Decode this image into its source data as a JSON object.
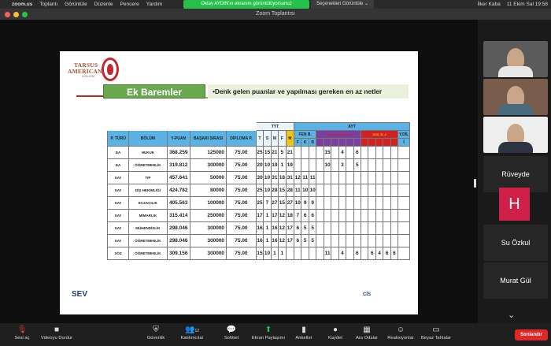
{
  "menubar": {
    "apple": "",
    "app": "zoom.us",
    "items": [
      "Toplantı",
      "Görüntüle",
      "Düzenle",
      "Pencere",
      "Yardım"
    ],
    "share_banner": "Oktay AYDIN'ın ekranını görüntülüyorsunuz",
    "share_options": "Seçenekleri Görüntüle ⌄",
    "user": "İlker Kaba",
    "datetime": "11 Ekim Sal 19:58"
  },
  "window": {
    "title": "Zoom Toplantısı"
  },
  "slide": {
    "logo": [
      "TARSUS",
      "AMERICAN",
      "COLLEGE"
    ],
    "heading": "Ek Baremler",
    "subheading": "•Denk gelen puanlar ve yapılması gereken en az netler",
    "table": {
      "header_top": [
        "TYT",
        "AYT"
      ],
      "columns": [
        "P. TÜRÜ",
        "BÖLÜM",
        "Y-PUAN",
        "BAŞARI SIRASI",
        "DİPLOMA P."
      ],
      "tyt_sub": [
        "T",
        "S",
        "M",
        "F"
      ],
      "m": "M",
      "fen_b": "FEN B.",
      "fen_sub": [
        "F",
        "K",
        "B"
      ],
      "ayt_groups": [
        "T. ED. ve SOS. B.-1",
        "SOS. B.-2"
      ],
      "ydil": "Y.DİL",
      "ydil_sub": "İ",
      "rows": [
        {
          "ptype": "EA",
          "dept": "HUKUK",
          "ypuan": "368.259",
          "rank": "125000",
          "dip": "75.00",
          "tyt": [
            "25",
            "15",
            "21",
            "5"
          ],
          "m": "21",
          "fen": [
            "",
            "",
            ""
          ],
          "s1": [
            "",
            "15",
            "",
            "4",
            "",
            "6"
          ],
          "s2": [
            "",
            "",
            "",
            "",
            ""
          ],
          "ydil": ""
        },
        {
          "ptype": "EA",
          "dept": "ÖĞRETMENLİK",
          "ypuan": "319.812",
          "rank": "300000",
          "dip": "75.00",
          "tyt": [
            "20",
            "10",
            "19",
            "1"
          ],
          "m": "19",
          "fen": [
            "",
            "",
            ""
          ],
          "s1": [
            "",
            "10",
            "",
            "3",
            "",
            "5"
          ],
          "s2": [
            "",
            "",
            "",
            "",
            ""
          ],
          "ydil": ""
        },
        {
          "ptype": "SAY",
          "dept": "TIP",
          "ypuan": "457.641",
          "rank": "50000",
          "dip": "75.00",
          "tyt": [
            "30",
            "10",
            "31",
            "18"
          ],
          "m": "31",
          "fen": [
            "12",
            "11",
            "11"
          ],
          "s1": [
            "",
            "",
            "",
            "",
            "",
            ""
          ],
          "s2": [
            "",
            "",
            "",
            "",
            ""
          ],
          "ydil": ""
        },
        {
          "ptype": "SAY",
          "dept": "DİŞ HEKİMLİĞİ",
          "ypuan": "424.782",
          "rank": "80000",
          "dip": "75.00",
          "tyt": [
            "25",
            "10",
            "28",
            "15"
          ],
          "m": "28",
          "fen": [
            "11",
            "10",
            "10"
          ],
          "s1": [
            "",
            "",
            "",
            "",
            "",
            ""
          ],
          "s2": [
            "",
            "",
            "",
            "",
            ""
          ],
          "ydil": ""
        },
        {
          "ptype": "SAY",
          "dept": "ECZACILIK",
          "ypuan": "405.563",
          "rank": "100000",
          "dip": "75.00",
          "tyt": [
            "25",
            "7",
            "27",
            "15"
          ],
          "m": "27",
          "fen": [
            "10",
            "9",
            "9"
          ],
          "s1": [
            "",
            "",
            "",
            "",
            "",
            ""
          ],
          "s2": [
            "",
            "",
            "",
            "",
            ""
          ],
          "ydil": ""
        },
        {
          "ptype": "SAY",
          "dept": "MİMARLIK",
          "ypuan": "315.414",
          "rank": "250000",
          "dip": "75.00",
          "tyt": [
            "17",
            "1",
            "17",
            "12"
          ],
          "m": "18",
          "fen": [
            "7",
            "6",
            "6"
          ],
          "s1": [
            "",
            "",
            "",
            "",
            "",
            ""
          ],
          "s2": [
            "",
            "",
            "",
            "",
            ""
          ],
          "ydil": ""
        },
        {
          "ptype": "SAY",
          "dept": "MÜHENDİSLİK",
          "ypuan": "298.046",
          "rank": "300000",
          "dip": "75.00",
          "tyt": [
            "16",
            "1",
            "16",
            "12"
          ],
          "m": "17",
          "fen": [
            "6",
            "5",
            "5"
          ],
          "s1": [
            "",
            "",
            "",
            "",
            "",
            ""
          ],
          "s2": [
            "",
            "",
            "",
            "",
            ""
          ],
          "ydil": ""
        },
        {
          "ptype": "SAY",
          "dept": "ÖĞRETMENLİK",
          "ypuan": "298.046",
          "rank": "300000",
          "dip": "75.00",
          "tyt": [
            "16",
            "1",
            "16",
            "12"
          ],
          "m": "17",
          "fen": [
            "6",
            "5",
            "5"
          ],
          "s1": [
            "",
            "",
            "",
            "",
            "",
            ""
          ],
          "s2": [
            "",
            "",
            "",
            "",
            ""
          ],
          "ydil": ""
        },
        {
          "ptype": "SÖZ",
          "dept": "ÖĞRETMENLİK",
          "ypuan": "309.156",
          "rank": "300000",
          "dip": "75.00",
          "tyt": [
            "15",
            "10",
            "1",
            "1"
          ],
          "m": "",
          "fen": [
            "",
            "",
            ""
          ],
          "s1": [
            "",
            "11",
            "",
            "4",
            "",
            "6"
          ],
          "s2": [
            "",
            "6",
            "4",
            "6",
            "6"
          ],
          "ydil": ""
        }
      ]
    },
    "footer_left": "SEV",
    "footer_right": "CİS"
  },
  "participants": [
    {
      "name": "",
      "kind": "video"
    },
    {
      "name": "",
      "kind": "video"
    },
    {
      "name": "",
      "kind": "video"
    },
    {
      "name": "Rüveyde",
      "kind": "name"
    },
    {
      "name": "H",
      "kind": "initial"
    },
    {
      "name": "Su Özkul",
      "kind": "name"
    },
    {
      "name": "Murat Gül",
      "kind": "name"
    }
  ],
  "toolbar": {
    "items": [
      {
        "label": "Sesi aç",
        "icon": "🎙"
      },
      {
        "label": "Videoyu Durdur",
        "icon": "■"
      },
      {
        "label": "Güvenlik",
        "icon": "⛨"
      },
      {
        "label": "Katılımcılar",
        "icon": "👥",
        "badge": "12"
      },
      {
        "label": "Sohbet",
        "icon": "💬"
      },
      {
        "label": "Ekran Paylaşımı",
        "icon": "⬆"
      },
      {
        "label": "Anketler",
        "icon": "▮"
      },
      {
        "label": "Kaydet",
        "icon": "●"
      },
      {
        "label": "Ara Odalar",
        "icon": "▦"
      },
      {
        "label": "Reaksiyonlar",
        "icon": "☺"
      },
      {
        "label": "Beyaz Tahtalar",
        "icon": "▭"
      }
    ],
    "end_button": "Sonlandır"
  },
  "colors": {
    "table_header": "#5ab2e5",
    "m_column": "#f0c419",
    "ayt_social1": "#7b3fa0",
    "ayt_social2": "#d12121",
    "green": "#6aa84f",
    "end": "#e02828"
  }
}
